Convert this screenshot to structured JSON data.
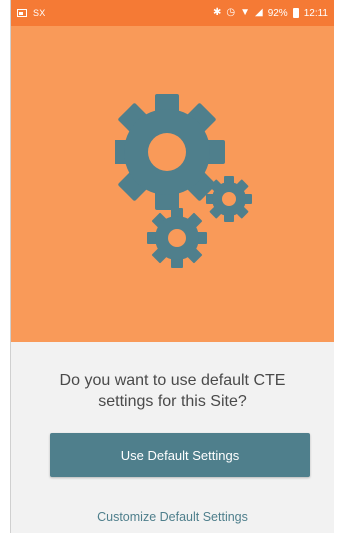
{
  "status_bar": {
    "carrier": "SX",
    "battery": "92%",
    "time": "12:11",
    "icons": [
      "image-icon",
      "bluetooth-icon",
      "alarm-icon",
      "wifi-icon",
      "signal-icon",
      "battery-icon"
    ]
  },
  "hero": {
    "illustration": "gears-icon",
    "background_color": "#f99a59",
    "gear_color": "#4f7f8c"
  },
  "dialog": {
    "question": "Do you want to use default CTE settings for this Site?",
    "primary_button": "Use Default Settings",
    "secondary_link": "Customize Default Settings"
  },
  "colors": {
    "status_bar": "#f57a35",
    "accent": "#4f7f8c",
    "panel": "#f2f2f2"
  }
}
